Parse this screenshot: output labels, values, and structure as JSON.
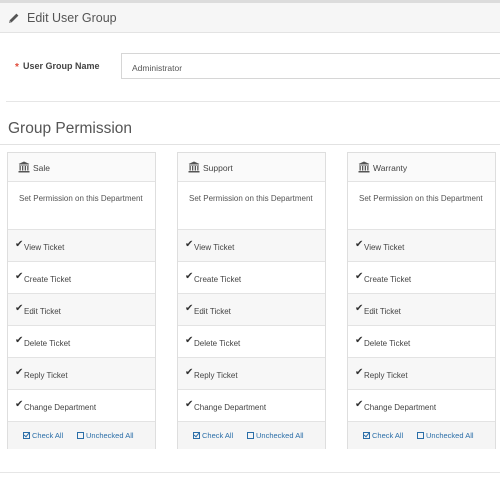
{
  "header": {
    "title": "Edit User Group",
    "icon": "pencil-icon"
  },
  "form": {
    "required_marker": "*",
    "group_name_label": "User Group Name",
    "group_name_value": "Administrator"
  },
  "section": {
    "title": "Group Permission"
  },
  "departments": [
    {
      "name": "Sale",
      "icon": "bank-icon",
      "description": "Set Permission on this Department",
      "permissions": [
        "View Ticket",
        "Create Ticket",
        "Edit Ticket",
        "Delete Ticket",
        "Reply Ticket",
        "Change Department"
      ],
      "check_all_label": "Check All",
      "uncheck_all_label": "Unchecked All"
    },
    {
      "name": "Support",
      "icon": "bank-icon",
      "description": "Set Permission on this Department",
      "permissions": [
        "View Ticket",
        "Create Ticket",
        "Edit Ticket",
        "Delete Ticket",
        "Reply Ticket",
        "Change Department"
      ],
      "check_all_label": "Check All",
      "uncheck_all_label": "Unchecked All"
    },
    {
      "name": "Warranty",
      "icon": "bank-icon",
      "description": "Set Permission on this Department",
      "permissions": [
        "View Ticket",
        "Create Ticket",
        "Edit Ticket",
        "Delete Ticket",
        "Reply Ticket",
        "Change Department"
      ],
      "check_all_label": "Check All",
      "uncheck_all_label": "Unchecked All"
    }
  ],
  "colors": {
    "required": "#e04b3a",
    "link": "#2a6ea8"
  }
}
